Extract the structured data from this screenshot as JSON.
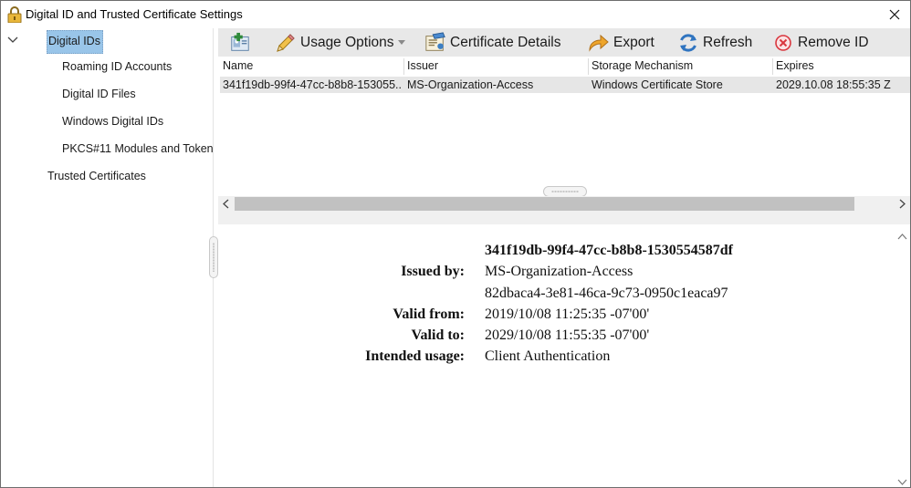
{
  "window": {
    "title": "Digital ID and Trusted Certificate Settings"
  },
  "icons": {
    "title": "certificate-lock-icon",
    "close": "close-icon",
    "tree_toggle": "chevron-down-icon",
    "add_id": "add-id-icon",
    "usage_options": "pencil-icon",
    "certificate_details": "certificate-icon",
    "export": "export-arrow-icon",
    "refresh": "refresh-icon",
    "remove": "remove-circle-icon"
  },
  "sidebar": {
    "root": "Digital IDs",
    "children": [
      "Roaming ID Accounts",
      "Digital ID Files",
      "Windows Digital IDs",
      "PKCS#11 Modules and Token"
    ],
    "trusted": "Trusted Certificates"
  },
  "toolbar": {
    "usage_options": "Usage Options",
    "certificate_details": "Certificate Details",
    "export": "Export",
    "refresh": "Refresh",
    "remove_id": "Remove ID"
  },
  "table": {
    "columns": [
      "Name",
      "Issuer",
      "Storage Mechanism",
      "Expires"
    ],
    "rows": [
      [
        "341f19db-99f4-47cc-b8b8-153055...",
        "MS-Organization-Access",
        "Windows Certificate Store",
        "2029.10.08 18:55:35 Z"
      ]
    ]
  },
  "details": {
    "title": "341f19db-99f4-47cc-b8b8-1530554587df",
    "issued_by_label": "Issued by:",
    "issued_by": "MS-Organization-Access",
    "issued_by_2": "82dbaca4-3e81-46ca-9c73-0950c1eaca97",
    "valid_from_label": "Valid from:",
    "valid_from": "2019/10/08 11:25:35 -07'00'",
    "valid_to_label": "Valid to:",
    "valid_to": "2029/10/08 11:55:35 -07'00'",
    "usage_label": "Intended usage:",
    "usage": "Client Authentication"
  },
  "colors": {
    "selection": "#99c5e9",
    "toolbar_bg": "#e8e8e8",
    "row_selected": "#e6e6e6",
    "remove_red": "#d9363e",
    "export_orange": "#e8961e",
    "refresh_blue": "#2f74c0"
  }
}
